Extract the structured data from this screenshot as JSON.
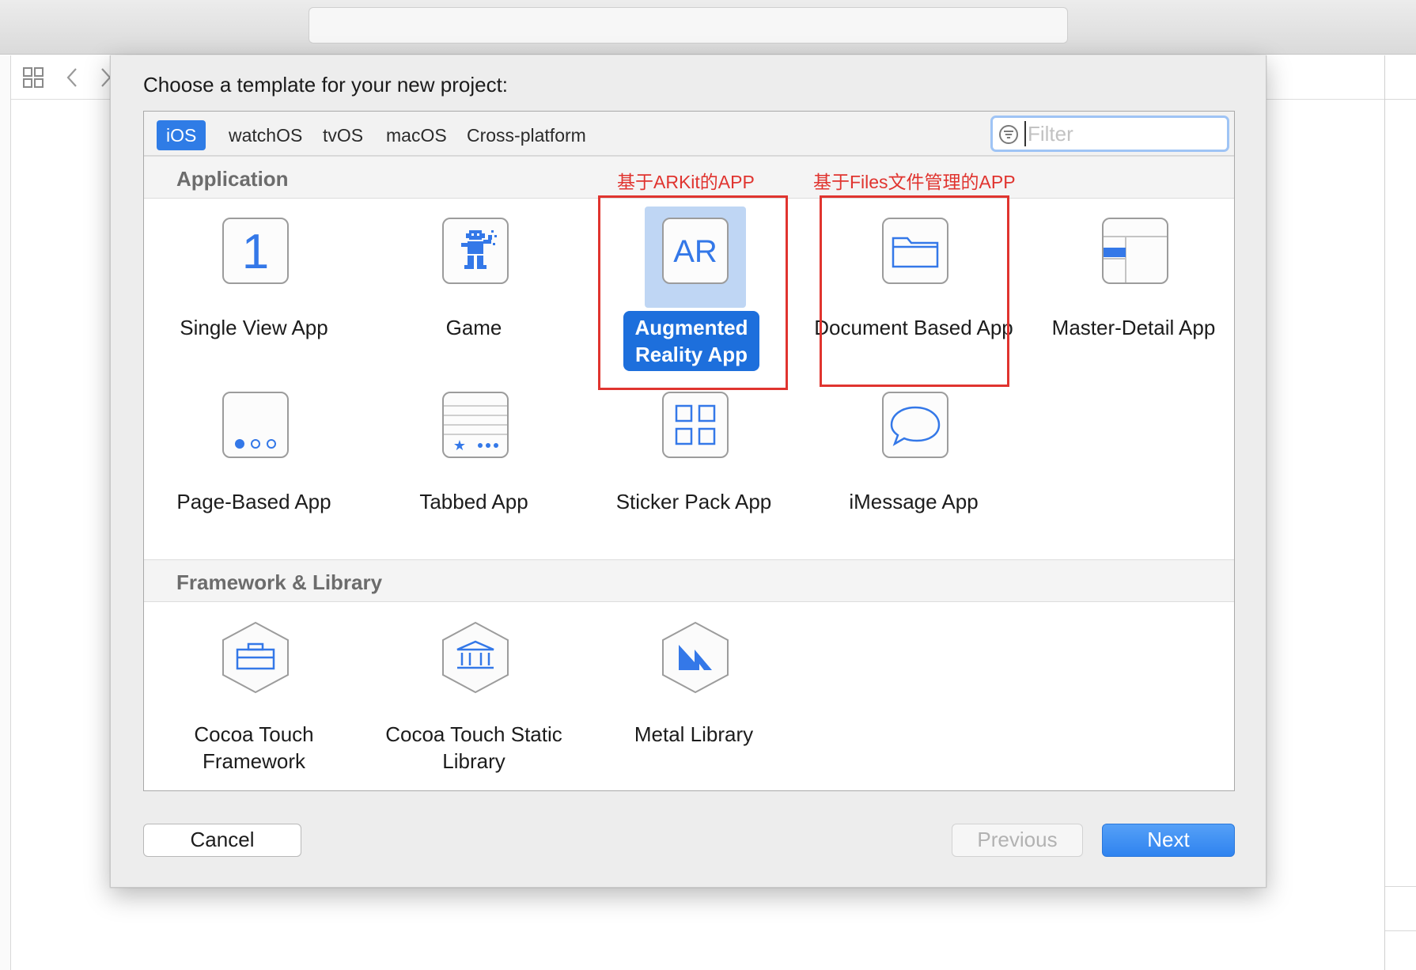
{
  "dialog": {
    "title": "Choose a template for your new project:"
  },
  "tabs": [
    {
      "label": "iOS",
      "active": true
    },
    {
      "label": "watchOS",
      "active": false
    },
    {
      "label": "tvOS",
      "active": false
    },
    {
      "label": "macOS",
      "active": false
    },
    {
      "label": "Cross-platform",
      "active": false
    }
  ],
  "filter": {
    "placeholder": "Filter",
    "value": ""
  },
  "sections": {
    "application": "Application",
    "framework": "Framework & Library"
  },
  "application_templates": [
    {
      "label": "Single View App",
      "icon": "single-view-icon",
      "glyph": "1"
    },
    {
      "label": "Game",
      "icon": "game-icon"
    },
    {
      "label": "Augmented Reality App",
      "icon": "ar-icon",
      "glyph": "AR",
      "selected": true
    },
    {
      "label": "Document Based App",
      "icon": "folder-icon"
    },
    {
      "label": "Master-Detail App",
      "icon": "master-detail-icon"
    },
    {
      "label": "Page-Based App",
      "icon": "page-dots-icon"
    },
    {
      "label": "Tabbed App",
      "icon": "tab-bar-icon"
    },
    {
      "label": "Sticker Pack App",
      "icon": "sticker-grid-icon"
    },
    {
      "label": "iMessage App",
      "icon": "speech-bubble-icon"
    }
  ],
  "framework_templates": [
    {
      "label": "Cocoa Touch Framework",
      "icon": "toolbox-icon"
    },
    {
      "label": "Cocoa Touch Static Library",
      "icon": "building-icon"
    },
    {
      "label": "Metal Library",
      "icon": "metal-icon"
    }
  ],
  "annotations": {
    "ar": "基于ARKit的APP",
    "doc": "基于Files文件管理的APP"
  },
  "buttons": {
    "cancel": "Cancel",
    "previous": "Previous",
    "next": "Next"
  },
  "colors": {
    "accent": "#2f7ce6",
    "selection": "#1d6fdc",
    "annotation": "#e0342f",
    "icon_blue": "#3478e8"
  }
}
